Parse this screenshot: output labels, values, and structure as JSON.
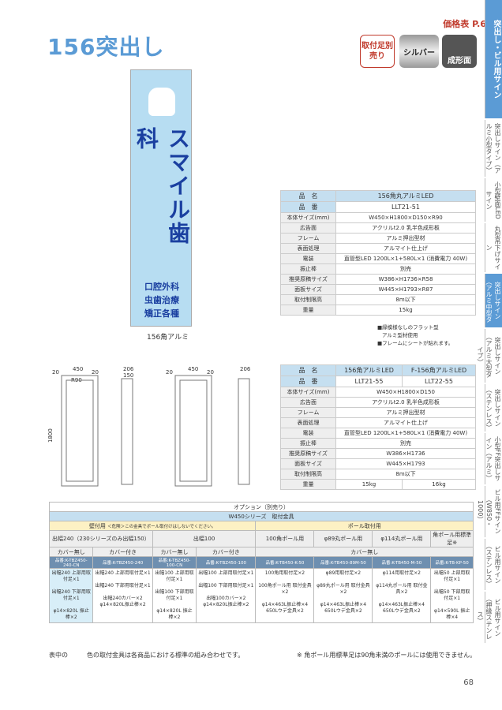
{
  "header": {
    "title": "156突出し",
    "page_ref": "価格表 P.6",
    "badges": [
      "取付足別売り",
      "シルバー",
      "成形面"
    ]
  },
  "sidebar": {
    "active": "突出し・ビル用サイン",
    "items": [
      "突出しサイン（アルミ小型タイプ）",
      "小型壁面LEDサイン",
      "丸型吊下げサイン",
      "突出しサイン（アルミ中型タイプ）",
      "突出しサイン（アルミ大型タイプ）",
      "突出しサイン（ステンレス）",
      "小型FF突出しサイン（アルミ）",
      "ビル用FFサイン（W850・1000）",
      "ビル用サイン（ステンレス）",
      "ビル用サイン（押縁ステンレス）"
    ]
  },
  "sign": {
    "main": "スマイル歯科",
    "lines": [
      "口腔外科",
      "虫歯治療",
      "矯正各種"
    ],
    "caption": "156角アルミ"
  },
  "spec1": {
    "header": [
      "品　名",
      "156角丸アルミLED"
    ],
    "code": [
      "品　番",
      "LLT21-51"
    ],
    "rows": [
      [
        "本体サイズ(mm)",
        "W450×H1800×D150×R90"
      ],
      [
        "広告面",
        "アクリルt2.0 乳半色成形板"
      ],
      [
        "フレーム",
        "アルミ押出型材"
      ],
      [
        "表面処理",
        "アルマイト仕上げ"
      ],
      [
        "電装",
        "直管型LED 1200L×1+580L×1 (消費電力 40W)"
      ],
      [
        "振止棒",
        "別売"
      ],
      [
        "推奨原稿サイズ",
        "W386×H1736×R58"
      ],
      [
        "面板サイズ",
        "W445×H1793×R87"
      ],
      [
        "取付制限高",
        "8m以下"
      ],
      [
        "重量",
        "15kg"
      ]
    ]
  },
  "notes": [
    "■縁模様なしのフラット型",
    "アルミ型材使用",
    "■フレームにシートが貼れます。"
  ],
  "spec2": {
    "header": [
      "品　名",
      "156角アルミLED",
      "F-156角アルミLED"
    ],
    "code": [
      "品　番",
      "LLT21-55",
      "LLT22-55"
    ],
    "rows": [
      [
        "本体サイズ(mm)",
        "W450×H1800×D150"
      ],
      [
        "広告面",
        "アクリルt2.0 乳半色成形板"
      ],
      [
        "フレーム",
        "アルミ押出型材"
      ],
      [
        "表面処理",
        "アルマイト仕上げ"
      ],
      [
        "電装",
        "直管型LED 1200L×1+580L×1 (消費電力 40W)"
      ],
      [
        "振止棒",
        "別売"
      ],
      [
        "推奨原稿サイズ",
        "W386×H1736"
      ],
      [
        "面板サイズ",
        "W445×H1793"
      ],
      [
        "取付制限高",
        "8m以下"
      ]
    ],
    "weight": [
      "重量",
      "15kg",
      "16kg"
    ]
  },
  "dims": {
    "w": "450",
    "side": "20",
    "h": "1800",
    "b": "20",
    "d": "206",
    "d2": "150",
    "r": "R90"
  },
  "options": {
    "title": "オプション（別売り）",
    "series": "W450シリーズ　取付金具",
    "wall": "壁付用",
    "wall_note": "＜危険＞この金具でポール取付けはしないでください。",
    "pole": "ポール取付用",
    "sub": [
      "出幅240（230シリーズのみ出幅150）",
      "出幅100",
      "100角ポール用",
      "φ89丸ポール用",
      "φ114丸ポール用",
      "角ポール用標準足※"
    ],
    "cover": [
      "カバー無し",
      "カバー付き",
      "カバー無し",
      "カバー付き",
      "カバー無し"
    ],
    "parts": [
      "品番:K-TBZ450-240-CN",
      "品番:K-TBZ450-240",
      "品番:K-TBZ450-100-CN",
      "品番:K-TBZ450-100",
      "品番:K-TB450-K-50",
      "品番:K-TB450-89M-50",
      "品番:K-TB450-M-50",
      "品番:K-TB-KP-50"
    ],
    "cells": [
      [
        "出幅240 上部用取付足×1",
        "出幅240 下部用取付足×1",
        "φ14×820L 振止棒×2"
      ],
      [
        "出幅240 上部用取付足×1",
        "出幅240 下部用取付足×1",
        "出幅240カバー×2 φ14×820L振止棒×2"
      ],
      [
        "出幅100 上部用取付足×1",
        "出幅100 下部用取付足×1",
        "φ14×820L 振止棒×2"
      ],
      [
        "出幅100 上部用取付足×1",
        "出幅100 下部用取付足×1",
        "出幅100カバー×2 φ14×820L振止棒×2"
      ],
      [
        "100角用取付足×2",
        "100角ポール用 取付金具×2",
        "φ14×463L振止棒×4 650Lウデ金具×2"
      ],
      [
        "φ89用取付足×2",
        "φ89丸ポール用 取付金具×2",
        "φ14×463L振止棒×4 650Lウデ金具×2"
      ],
      [
        "φ114用取付足×2",
        "φ114丸ポール用 取付金具×2",
        "φ14×463L振止棒×4 650Lウデ金具×2"
      ],
      [
        "出幅50 上部用取付足×1",
        "出幅50 下部用取付足×1",
        "φ14×590L 振止棒×4"
      ]
    ]
  },
  "footer": {
    "left": "表中の　　　色の取付金具は各商品における標準の組み合わせです。",
    "right": "※ 角ポール用標準足は90角未満のポールには使用できません。",
    "page": "68"
  },
  "colors": {
    "accent": "#5b9bd5",
    "red": "#c0392b",
    "sign": "#b7ddf2"
  }
}
